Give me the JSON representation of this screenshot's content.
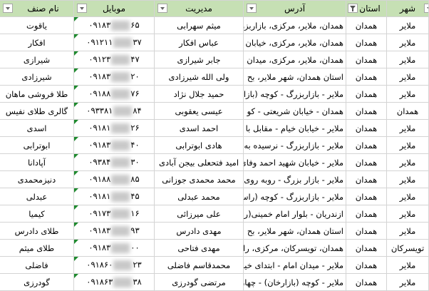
{
  "header": {
    "city": "شهر",
    "province": "استان",
    "address": "آدرس",
    "manager": "مدیریت",
    "mobile": "موبایل",
    "guild_name": "نام صنف"
  },
  "colors": {
    "header_bg": "#c6e0b4",
    "grid": "#d4d4d4",
    "text_marker": "#1e8a2e"
  },
  "rows": [
    {
      "city": "ملایر",
      "province": "همدان",
      "address": "همدان، ملایر، مرکزی، بازاربزرگ",
      "manager": "میثم سهرابی",
      "mobile_start": "۰۹۱۸۳",
      "mobile_end": "۶۵",
      "name": "یاقوت"
    },
    {
      "city": "ملایر",
      "province": "همدان",
      "address": "همدان، ملایر، مرکزی، خیابان",
      "manager": "عباس افکار",
      "mobile_start": "۰۹۱۲۱۱",
      "mobile_end": "۳۷",
      "name": "افکار"
    },
    {
      "city": "ملایر",
      "province": "همدان",
      "address": "همدان، ملایر، مرکزی، میدان ا",
      "manager": "جابر شیرازی",
      "mobile_start": "۰۹۱۲۳",
      "mobile_end": "۴۷",
      "name": "شیرازی"
    },
    {
      "city": "ملایر",
      "province": "همدان",
      "address": "استان همدان،  شهر ملایر،  بح",
      "manager": "ولی الله شیرزادی",
      "mobile_start": "۰۹۱۸۳",
      "mobile_end": "۲۰",
      "name": "شیرزادی"
    },
    {
      "city": "ملایر",
      "province": "همدان",
      "address": "ملایر - بازاربزرگ - کوچه (بازار",
      "manager": "حمید جلال نژاد",
      "mobile_start": "۰۹۱۸۸",
      "mobile_end": "۷۶",
      "name": "طلا فروشی ماهان"
    },
    {
      "city": "همدان",
      "province": "همدان",
      "address": "همدان - خیابان شریعتی - کو",
      "manager": "عیسی یعقوبی",
      "mobile_start": "۰۹۳۳۸۱",
      "mobile_end": "۸۴",
      "name": "گالری طلای نفیس"
    },
    {
      "city": "ملایر",
      "province": "همدان",
      "address": "ملایر - خیابان خیام - مقابل با",
      "manager": "احمد اسدی",
      "mobile_start": "۰۹۱۸۱",
      "mobile_end": "۲۶",
      "name": "اسدی"
    },
    {
      "city": "ملایر",
      "province": "همدان",
      "address": "ملایر - بازاربزرگ - نرسیده به",
      "manager": "هادی ابوترابی",
      "mobile_start": "۰۹۱۸۳",
      "mobile_end": "۴۰",
      "name": "ابوترابی"
    },
    {
      "city": "ملایر",
      "province": "همدان",
      "address": "ملایر - خیابان شهید احمد وفای",
      "manager": "امید فتحعلی بیجن آبادی",
      "mobile_start": "۰۹۳۸۴",
      "mobile_end": "۳۰",
      "name": "آپادانا"
    },
    {
      "city": "ملایر",
      "province": "همدان",
      "address": "ملایر - بازار بزرگ - روبه روی",
      "manager": "محمد محمدی جوزانی",
      "mobile_start": "۰۹۱۸۸",
      "mobile_end": "۸۵",
      "name": "دنیزمحمدی"
    },
    {
      "city": "ملایر",
      "province": "همدان",
      "address": "ملایر - بازاربزرگ - کوچه (راسته",
      "manager": "محمد عبدلی",
      "mobile_start": "۰۹۱۸۱",
      "mobile_end": "۴۵",
      "name": "عبدلی"
    },
    {
      "city": "ملایر",
      "province": "همدان",
      "address": "ازندریان - بلوار امام خمینی(ره)",
      "manager": "علی میرزائی",
      "mobile_start": "۰۹۱۷۳",
      "mobile_end": "۱۶",
      "name": "کیمیا"
    },
    {
      "city": "ملایر",
      "province": "همدان",
      "address": "استان همدان،  شهر ملایر،  بح",
      "manager": "مهدی دادرس",
      "mobile_start": "۰۹۱۸۳",
      "mobile_end": "۹۳",
      "name": "طلای دادرس"
    },
    {
      "city": "تویسرکان",
      "province": "همدان",
      "address": "همدان، تویسرکان، مرکزی، راس",
      "manager": "مهدی فتاحی",
      "mobile_start": "۰۹۱۸۳",
      "mobile_end": "۰۰",
      "name": "طلای میثم"
    },
    {
      "city": "ملایر",
      "province": "همدان",
      "address": "ملایر - میدان امام - ابتدای خیا",
      "manager": "محمدقاسم فاضلی",
      "mobile_start": "۰۹۱۸۶۰",
      "mobile_end": "۲۳",
      "name": "فاضلی"
    },
    {
      "city": "ملایر",
      "province": "همدان",
      "address": "ملایر - کوچه (بازارخان) - چهار",
      "manager": "مرتضی گودرزی",
      "mobile_start": "۰۹۱۸۶۳",
      "mobile_end": "۳۸",
      "name": "گودرزی"
    }
  ]
}
